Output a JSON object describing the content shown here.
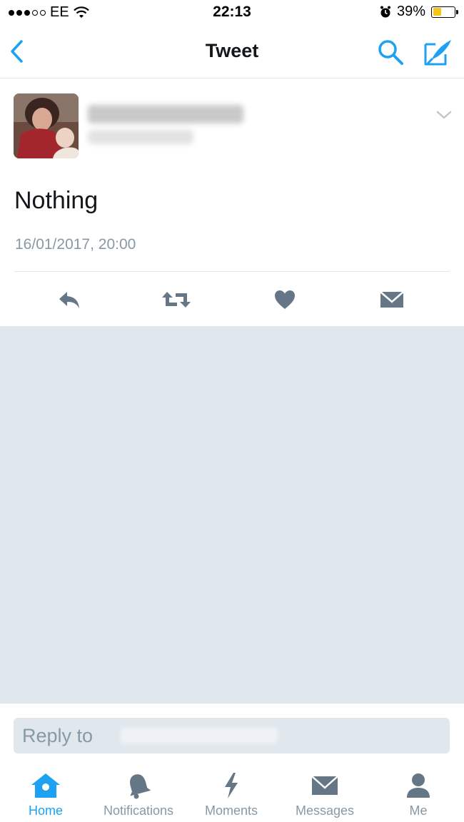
{
  "status_bar": {
    "carrier": "EE",
    "time": "22:13",
    "battery_percent": "39%",
    "battery_level": 0.39,
    "icons": [
      "signal-dots",
      "wifi-icon",
      "alarm-icon",
      "battery-icon"
    ]
  },
  "nav": {
    "title": "Tweet",
    "back_icon": "chevron-left-icon",
    "search_icon": "search-icon",
    "compose_icon": "compose-icon"
  },
  "tweet": {
    "text": "Nothing",
    "timestamp": "16/01/2017, 20:00",
    "caret_icon": "chevron-down-icon",
    "actions": [
      "reply-icon",
      "retweet-icon",
      "heart-icon",
      "envelope-icon"
    ]
  },
  "reply": {
    "placeholder": "Reply to"
  },
  "tab_bar": {
    "active": "Home",
    "tabs": [
      {
        "label": "Home",
        "icon": "home-icon"
      },
      {
        "label": "Notifications",
        "icon": "bell-icon"
      },
      {
        "label": "Moments",
        "icon": "lightning-icon"
      },
      {
        "label": "Messages",
        "icon": "envelope-icon"
      },
      {
        "label": "Me",
        "icon": "person-icon"
      }
    ]
  },
  "colors": {
    "accent": "#1da1f2",
    "muted": "#8899a6",
    "background_grey": "#e1e8ed",
    "battery": "#f5c518"
  }
}
